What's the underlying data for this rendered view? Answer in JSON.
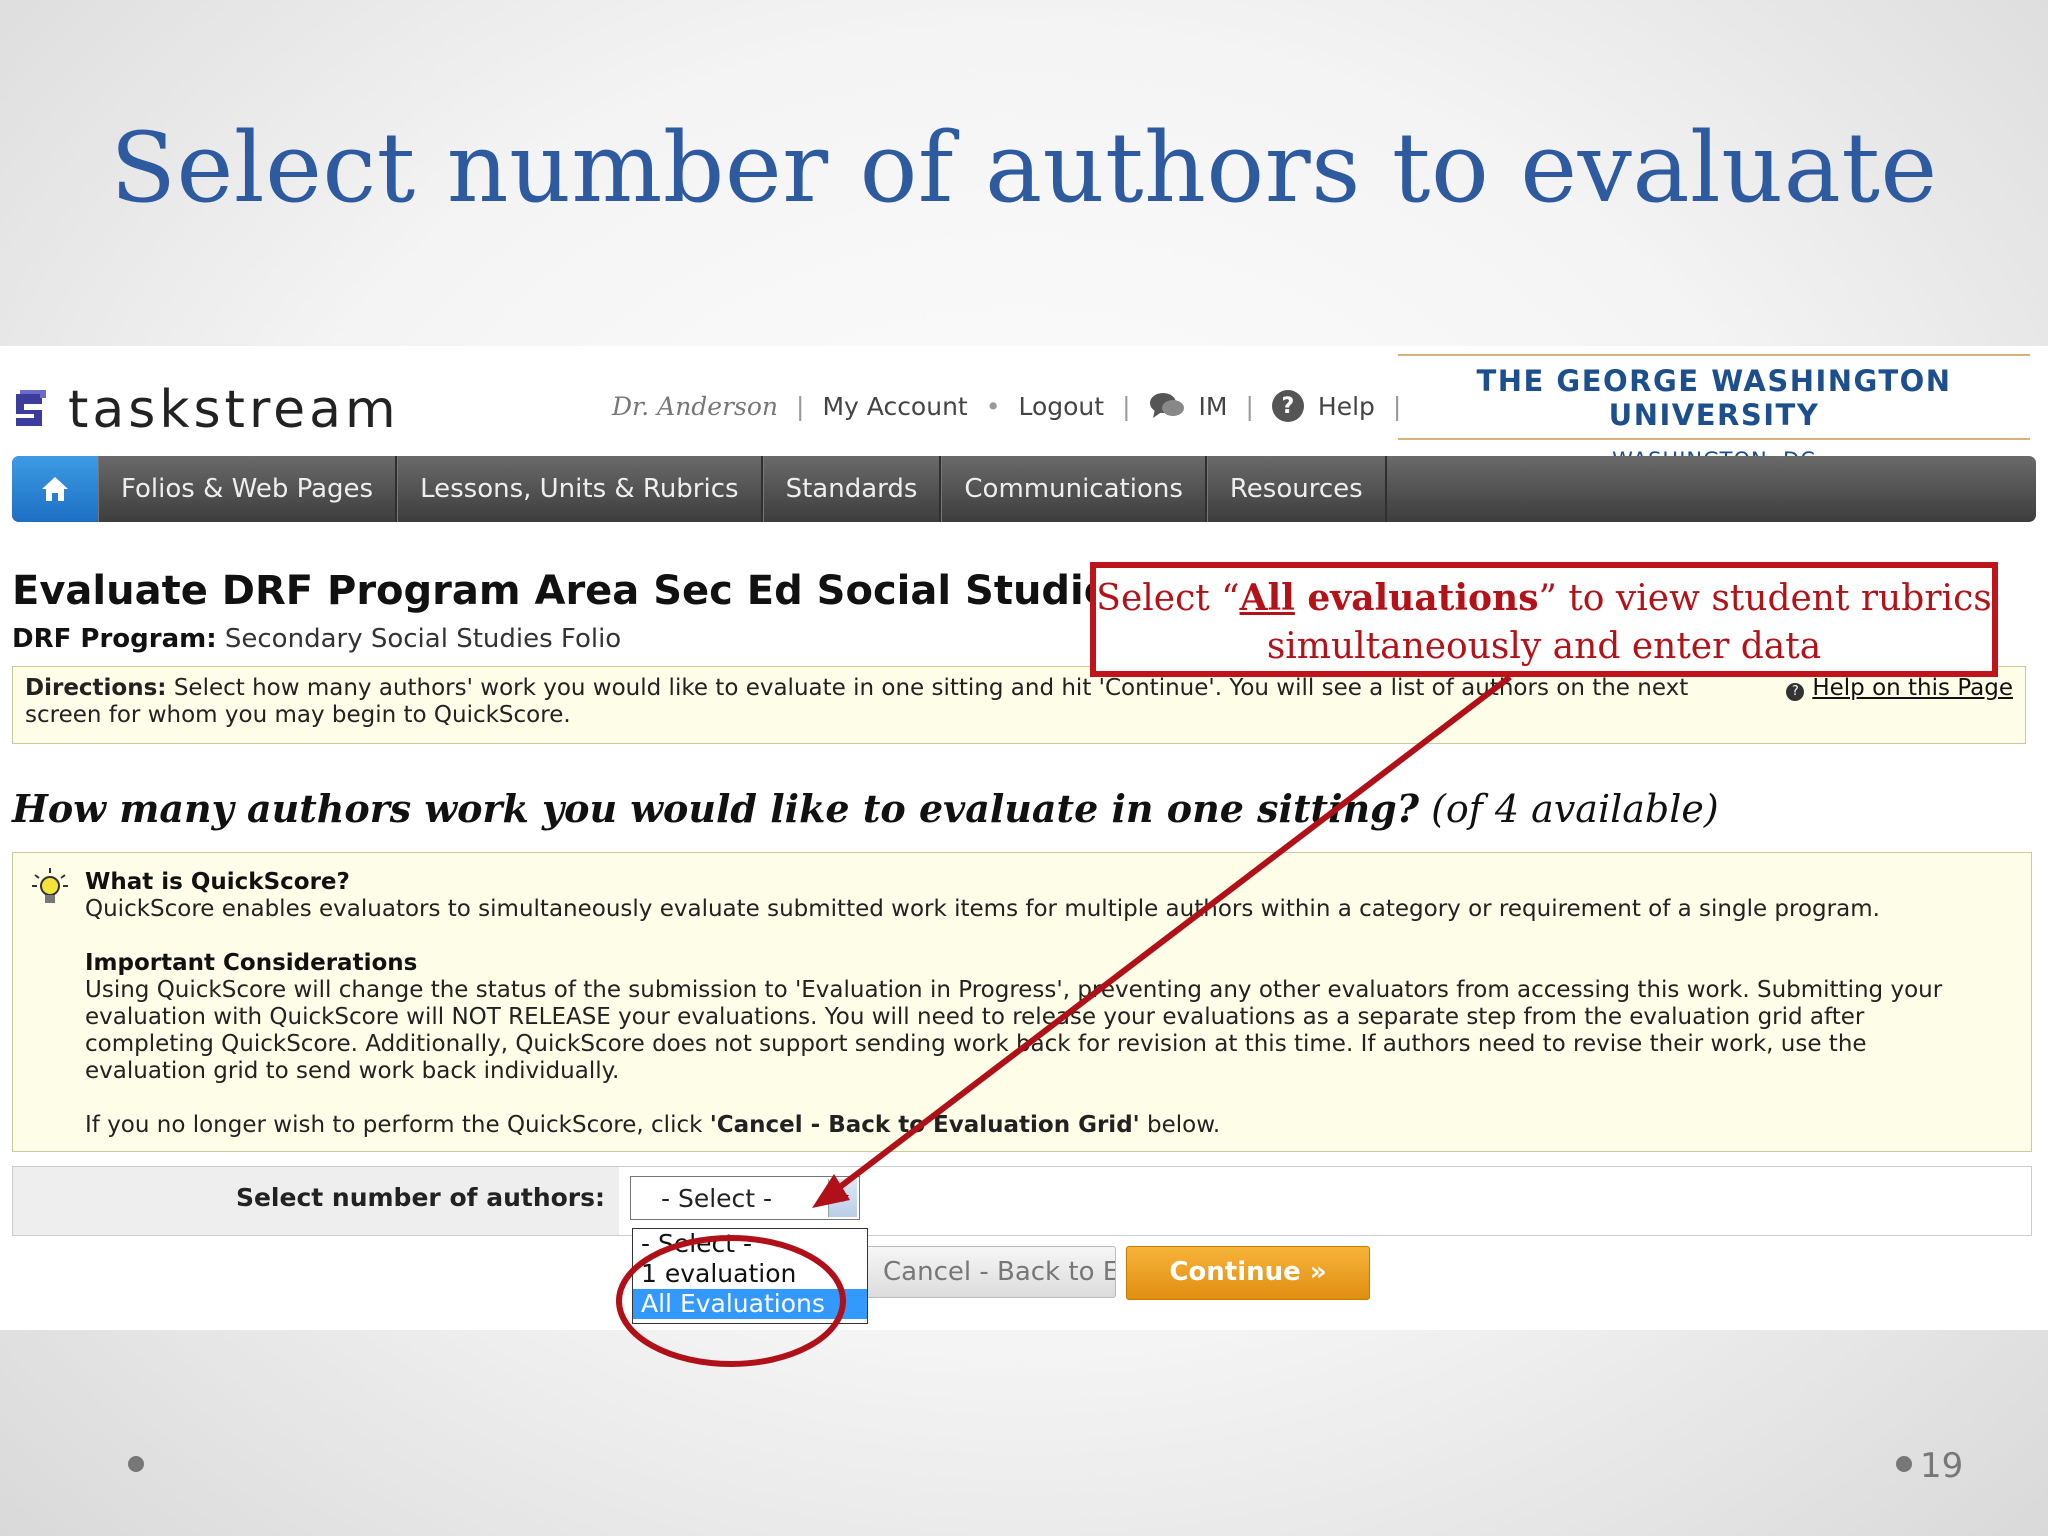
{
  "slide": {
    "title": "Select number of authors to evaluate",
    "page_number": "19"
  },
  "header": {
    "brand": "taskstream",
    "user": "Dr. Anderson",
    "my_account": "My Account",
    "logout": "Logout",
    "im": "IM",
    "help": "Help",
    "sep": "|",
    "dot": "•",
    "university": "THE GEORGE WASHINGTON UNIVERSITY",
    "university_location": "WASHINGTON, DC"
  },
  "nav": {
    "tabs": [
      "Folios & Web Pages",
      "Lessons, Units & Rubrics",
      "Standards",
      "Communications",
      "Resources"
    ]
  },
  "page": {
    "title": "Evaluate DRF Program Area Sec Ed Social Studies A",
    "program_label": "DRF Program:",
    "program_value": "Secondary Social Studies Folio",
    "directions_label": "Directions:",
    "directions_line1": "Select how many authors' work you would like to evaluate in one sitting and hit 'Continue'. You will see a list of authors on the next",
    "directions_line2": "screen for whom you may begin to QuickScore.",
    "help_link": "Help on this Page",
    "question": "How many authors work you would like to evaluate in one sitting?",
    "available": "(of 4 available)"
  },
  "quickscore": {
    "heading": "What is QuickScore?",
    "text": "QuickScore enables evaluators to simultaneously evaluate submitted work items for multiple authors within a category or requirement of a single program.",
    "considerations_heading": "Important Considerations",
    "considerations_line1": "Using QuickScore will change the status of the submission to 'Evaluation in Progress', preventing any other evaluators from accessing this work. Submitting your",
    "considerations_line2": "evaluation with QuickScore will NOT RELEASE your evaluations. You will need to release your evaluations as a separate step from the evaluation grid after",
    "considerations_line3": "completing QuickScore. Additionally, QuickScore does not support sending work back for revision at this time. If authors need to revise their work, use the",
    "considerations_line4": "evaluation grid to send work back individually.",
    "cancel_pre": "If you no longer wish to perform the QuickScore, click ",
    "cancel_bold": "'Cancel - Back to Evaluation Grid'",
    "cancel_post": " below."
  },
  "form": {
    "label": "Select number of authors:",
    "selected": "- Select -",
    "options": [
      "- Select -",
      "1 evaluation",
      "All Evaluations"
    ],
    "cancel_button": "Cancel - Back to Evaluation Grid",
    "continue_button": "Continue »"
  },
  "callout": {
    "pre": "Select “",
    "all": "All",
    "evaluations": " evaluations",
    "post": "” to view student rubrics",
    "line2": "simultaneously and enter data"
  },
  "colors": {
    "title_blue": "#2e5aa0",
    "callout_red": "#c0141c",
    "nav_home_blue": "#1d6fc3",
    "continue_orange": "#e08e10",
    "selected_option": "#3399ff"
  },
  "icons": [
    "home-icon",
    "im-chat-icon",
    "help-icon",
    "lightbulb-icon",
    "dropdown-arrow-icon",
    "question-mark-icon"
  ]
}
